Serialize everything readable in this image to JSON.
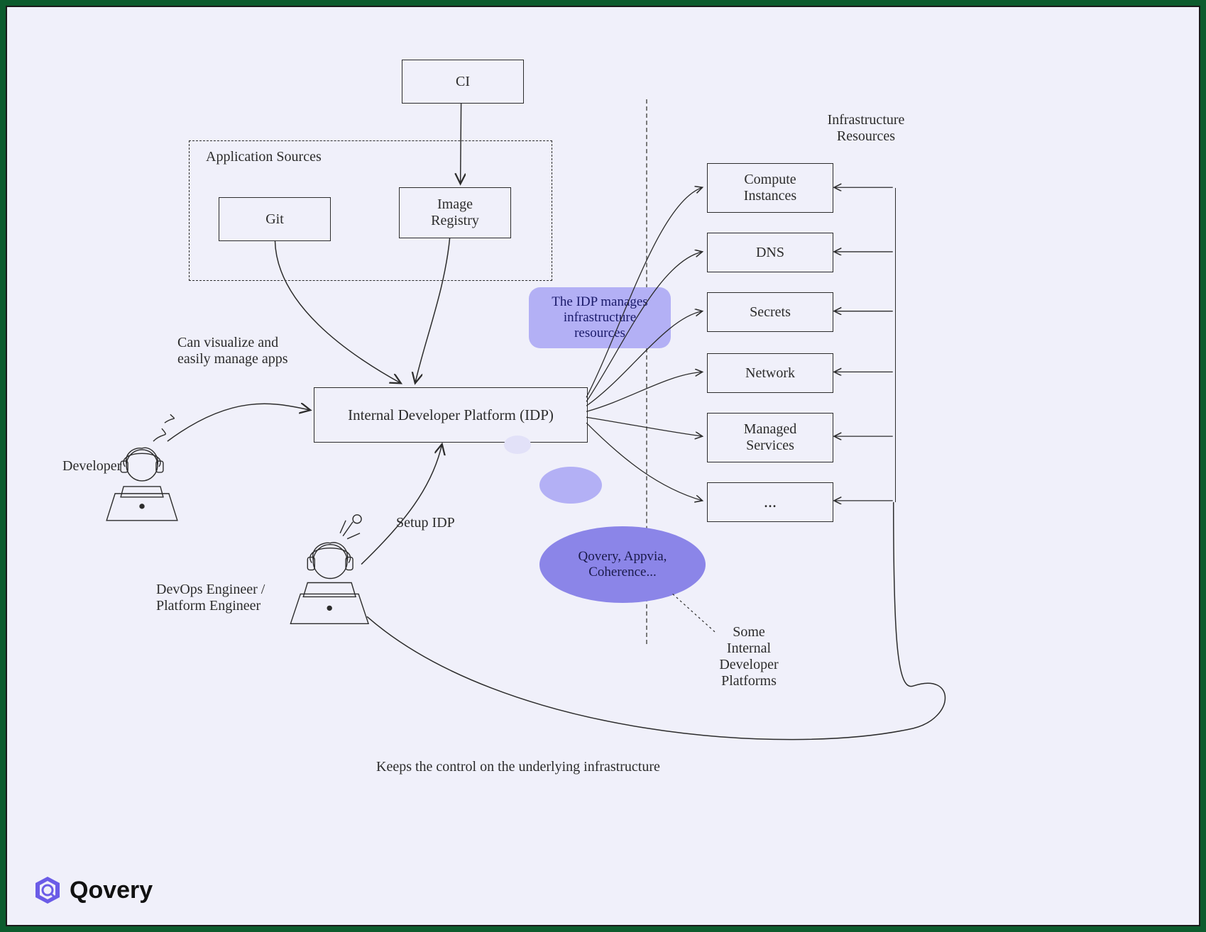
{
  "nodes": {
    "ci": "CI",
    "appSourcesTitle": "Application Sources",
    "git": "Git",
    "imageRegistry": "Image\nRegistry",
    "idp": "Internal Developer Platform (IDP)",
    "infraTitle": "Infrastructure\nResources",
    "compute": "Compute\nInstances",
    "dns": "DNS",
    "secrets": "Secrets",
    "network": "Network",
    "managed": "Managed\nServices",
    "more": "..."
  },
  "labels": {
    "devCanVisualize": "Can visualize and\neasily manage apps",
    "developer": "Developer",
    "devopsEngineer": "DevOps Engineer /\nPlatform Engineer",
    "setupIdp": "Setup IDP",
    "keepsControl": "Keeps the control on the underlying infrastructure",
    "someIdps": "Some\nInternal\nDeveloper\nPlatforms"
  },
  "callouts": {
    "idpManages": "The IDP manages\ninfrastructure\nresources",
    "examples": "Qovery, Appvia,\nCoherence..."
  },
  "brand": {
    "name": "Qovery"
  },
  "colors": {
    "lightPurple": "#b3b0f5",
    "medPurple": "#8b85e8",
    "paleCircle": "#cfcef7",
    "tinyCircle": "#e2e1f8"
  }
}
